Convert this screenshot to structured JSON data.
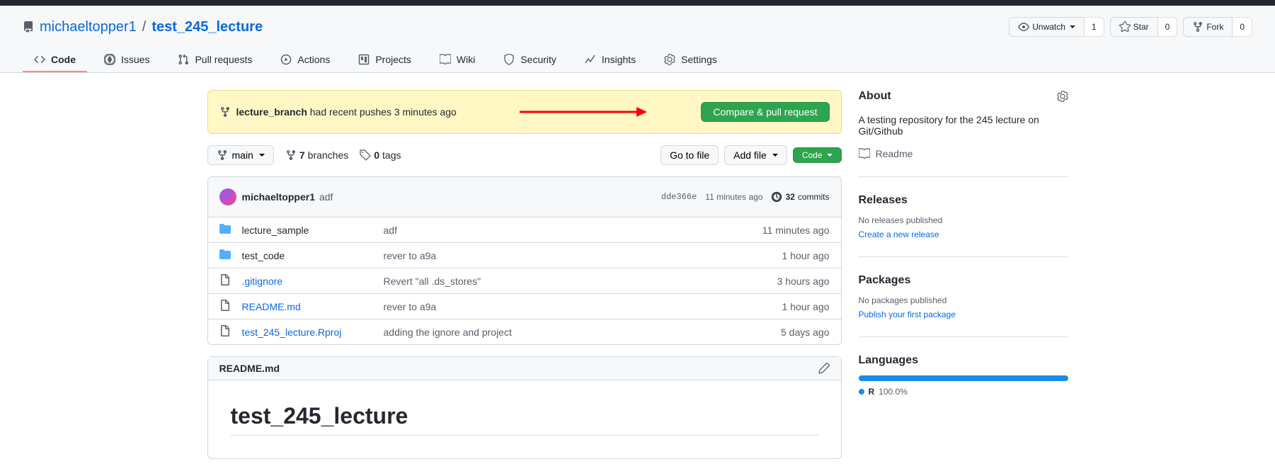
{
  "repo": {
    "owner": "michaeltopper1",
    "name": "test_245_lecture"
  },
  "actions": {
    "unwatch": {
      "label": "Unwatch",
      "count": "1"
    },
    "star": {
      "label": "Star",
      "count": "0"
    },
    "fork": {
      "label": "Fork",
      "count": "0"
    }
  },
  "tabs": [
    {
      "label": "Code"
    },
    {
      "label": "Issues"
    },
    {
      "label": "Pull requests"
    },
    {
      "label": "Actions"
    },
    {
      "label": "Projects"
    },
    {
      "label": "Wiki"
    },
    {
      "label": "Security"
    },
    {
      "label": "Insights"
    },
    {
      "label": "Settings"
    }
  ],
  "flash": {
    "branch": "lecture_branch",
    "msg": " had recent pushes 3 minutes ago",
    "cta": "Compare & pull request"
  },
  "branch_selector": "main",
  "branches": {
    "count": "7",
    "label": "branches"
  },
  "tags": {
    "count": "0",
    "label": "tags"
  },
  "file_nav": {
    "goto": "Go to file",
    "add": "Add file",
    "code": "Code"
  },
  "last_commit": {
    "author": "michaeltopper1",
    "msg": "adf",
    "sha": "dde366e",
    "time": "11 minutes ago",
    "commits_count": "32",
    "commits_label": "commits"
  },
  "files": [
    {
      "name": "lecture_sample",
      "type": "dir",
      "msg": "adf",
      "time": "11 minutes ago"
    },
    {
      "name": "test_code",
      "type": "dir",
      "msg": "rever to a9a",
      "time": "1 hour ago"
    },
    {
      "name": ".gitignore",
      "type": "file",
      "msg": "Revert \"all .ds_stores\"",
      "time": "3 hours ago"
    },
    {
      "name": "README.md",
      "type": "file",
      "msg": "rever to a9a",
      "time": "1 hour ago"
    },
    {
      "name": "test_245_lecture.Rproj",
      "type": "file",
      "msg": "adding the ignore and project",
      "time": "5 days ago"
    }
  ],
  "readme": {
    "filename": "README.md",
    "heading": "test_245_lecture"
  },
  "about": {
    "title": "About",
    "desc": "A testing repository for the 245 lecture on Git/Github",
    "readme_link": "Readme"
  },
  "releases": {
    "title": "Releases",
    "none": "No releases published",
    "action": "Create a new release"
  },
  "packages": {
    "title": "Packages",
    "none": "No packages published",
    "action": "Publish your first package"
  },
  "languages": {
    "title": "Languages",
    "items": [
      {
        "name": "R",
        "pct": "100.0%"
      }
    ]
  }
}
